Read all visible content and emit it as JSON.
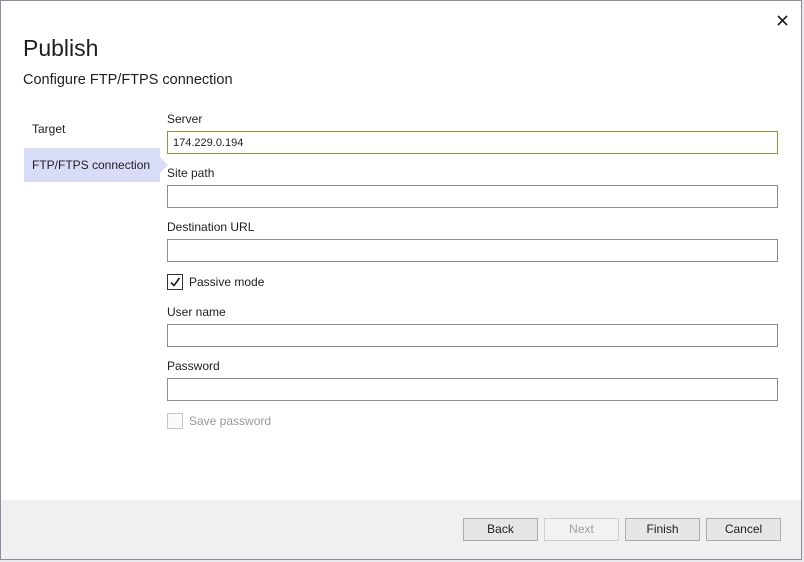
{
  "dialog": {
    "title": "Publish",
    "subtitle": "Configure FTP/FTPS connection"
  },
  "nav": {
    "items": [
      {
        "label": "Target",
        "selected": false
      },
      {
        "label": "FTP/FTPS connection",
        "selected": true
      }
    ]
  },
  "form": {
    "server_label": "Server",
    "server_value": "174.229.0.194",
    "site_path_label": "Site path",
    "site_path_value": "",
    "destination_url_label": "Destination URL",
    "destination_url_value": "",
    "passive_mode_label": "Passive mode",
    "passive_mode_checked": true,
    "user_name_label": "User name",
    "user_name_value": "",
    "password_label": "Password",
    "password_value": "",
    "save_password_label": "Save password",
    "save_password_checked": false,
    "save_password_enabled": false
  },
  "footer": {
    "back_label": "Back",
    "next_label": "Next",
    "finish_label": "Finish",
    "cancel_label": "Cancel"
  },
  "icons": {
    "close": "close-icon",
    "checkmark": "checkmark-icon"
  },
  "colors": {
    "nav_selected": "#d9dcf8",
    "focus_border": "#b08a3c",
    "footer_background": "#f0f0f3"
  }
}
